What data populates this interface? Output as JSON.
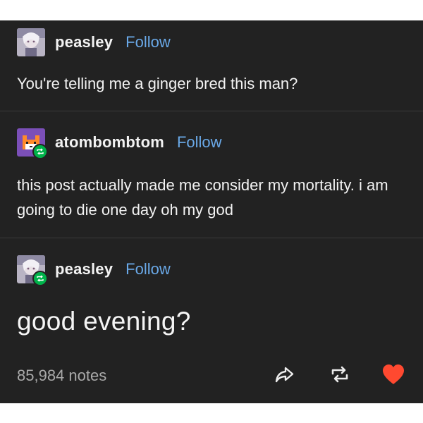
{
  "thread": [
    {
      "username": "peasley",
      "follow_label": "Follow",
      "avatar": "anime-character-avatar",
      "is_reblog": false,
      "text": "You're telling me a ginger bred this man?"
    },
    {
      "username": "atombombtom",
      "follow_label": "Follow",
      "avatar": "pixel-fox-avatar",
      "is_reblog": true,
      "text": "this post actually made me consider my mortality. i am going to die one day oh my god"
    },
    {
      "username": "peasley",
      "follow_label": "Follow",
      "avatar": "anime-character-avatar",
      "is_reblog": true,
      "text": "good evening?"
    }
  ],
  "footer": {
    "notes": "85,984 notes",
    "icons": [
      "share-icon",
      "reblog-icon",
      "like-heart-icon"
    ],
    "like_color": "#ff4930"
  },
  "colors": {
    "background": "#222222",
    "text": "#f2f2f2",
    "follow": "#6aa9e8",
    "reblog_badge": "#00b34a"
  }
}
